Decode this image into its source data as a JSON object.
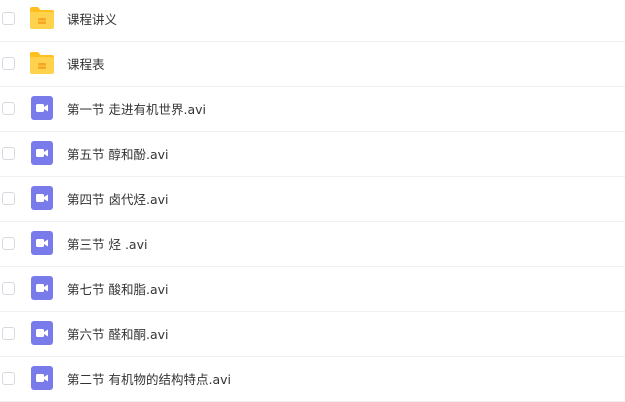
{
  "colors": {
    "folder_front": "#FFD24D",
    "folder_back": "#FFBF1F",
    "folder_badge": "#F5A623",
    "video_icon": "#7A7BEA",
    "divider": "#EEF0F2",
    "text": "#333333"
  },
  "files": [
    {
      "name": "课程讲义",
      "icon": "folder-icon"
    },
    {
      "name": "课程表",
      "icon": "folder-icon"
    },
    {
      "name": "第一节 走进有机世界.avi",
      "icon": "video-file-icon"
    },
    {
      "name": "第五节 醇和酚.avi",
      "icon": "video-file-icon"
    },
    {
      "name": "第四节 卤代烃.avi",
      "icon": "video-file-icon"
    },
    {
      "name": "第三节 烃 .avi",
      "icon": "video-file-icon"
    },
    {
      "name": "第七节 酸和脂.avi",
      "icon": "video-file-icon"
    },
    {
      "name": "第六节 醛和酮.avi",
      "icon": "video-file-icon"
    },
    {
      "name": "第二节 有机物的结构特点.avi",
      "icon": "video-file-icon"
    }
  ]
}
